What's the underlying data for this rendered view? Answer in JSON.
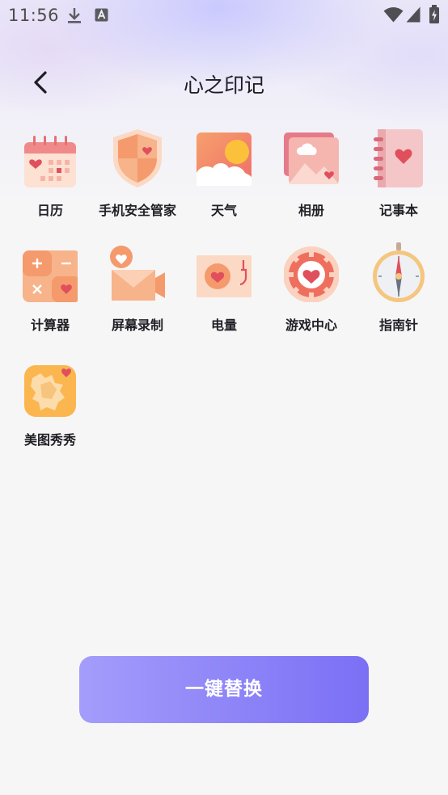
{
  "status_bar": {
    "time": "11:56",
    "left_icons": [
      "download-icon",
      "keyboard-a-icon"
    ],
    "right_icons": [
      "wifi-icon",
      "cell-signal-icon",
      "battery-charging-icon"
    ]
  },
  "header": {
    "title": "心之印记",
    "back_icon": "chevron-left-icon"
  },
  "apps": [
    {
      "label": "日历",
      "icon": "calendar-icon"
    },
    {
      "label": "手机安全管家",
      "icon": "shield-icon"
    },
    {
      "label": "天气",
      "icon": "weather-icon"
    },
    {
      "label": "相册",
      "icon": "gallery-icon"
    },
    {
      "label": "记事本",
      "icon": "notebook-icon"
    },
    {
      "label": "计算器",
      "icon": "calculator-icon"
    },
    {
      "label": "屏幕录制",
      "icon": "screen-record-icon"
    },
    {
      "label": "电量",
      "icon": "battery-icon"
    },
    {
      "label": "游戏中心",
      "icon": "game-center-icon"
    },
    {
      "label": "指南针",
      "icon": "compass-icon"
    },
    {
      "label": "美图秀秀",
      "icon": "meitu-icon"
    }
  ],
  "apply_button": {
    "label": "一键替换"
  },
  "colors": {
    "accent_start": "#a49dfb",
    "accent_end": "#7b6ff5",
    "icon_orange": "#f59a6c",
    "icon_pink": "#e57a8a",
    "heart_red": "#e0505c"
  }
}
